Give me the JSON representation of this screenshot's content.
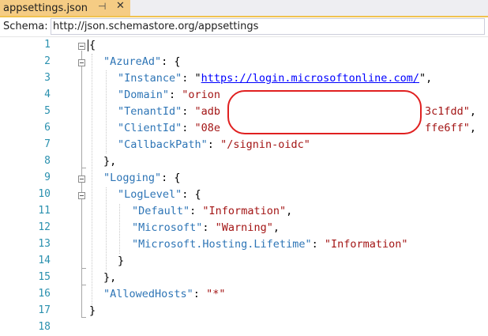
{
  "tab": {
    "title": "appsettings.json",
    "pin_glyph": "⊣",
    "close_glyph": "✕"
  },
  "schema": {
    "label": "Schema:",
    "value": "http://json.schemastore.org/appsettings"
  },
  "lines": [
    {
      "num": "1"
    },
    {
      "num": "2"
    },
    {
      "num": "3"
    },
    {
      "num": "4"
    },
    {
      "num": "5"
    },
    {
      "num": "6"
    },
    {
      "num": "7"
    },
    {
      "num": "8"
    },
    {
      "num": "9"
    },
    {
      "num": "10"
    },
    {
      "num": "11"
    },
    {
      "num": "12"
    },
    {
      "num": "13"
    },
    {
      "num": "14"
    },
    {
      "num": "15"
    },
    {
      "num": "16"
    },
    {
      "num": "17"
    },
    {
      "num": "18"
    }
  ],
  "code": {
    "l1_open": "{",
    "l2_key": "\"AzureAd\"",
    "l2_rest": ": {",
    "l3_key": "\"Instance\"",
    "l3_sep": ": \"",
    "l3_url": "https://login.microsoftonline.com/",
    "l3_end": "\",",
    "l4_key": "\"Domain\"",
    "l4_sep": ": ",
    "l4_val": "\"orion",
    "l5_key": "\"TenantId\"",
    "l5_sep": ": ",
    "l5_val_start": "\"adb",
    "l5_val_end": "3c1fdd\"",
    "l5_comma": ",",
    "l6_key": "\"ClientId\"",
    "l6_sep": ": ",
    "l6_val_start": "\"08e",
    "l6_val_end": "ffe6ff\"",
    "l6_comma": ",",
    "l7_key": "\"CallbackPath\"",
    "l7_sep": ": ",
    "l7_val": "\"/signin-oidc\"",
    "l8": "},",
    "l9_key": "\"Logging\"",
    "l9_rest": ": {",
    "l10_key": "\"LogLevel\"",
    "l10_rest": ": {",
    "l11_key": "\"Default\"",
    "l11_sep": ": ",
    "l11_val": "\"Information\"",
    "l11_comma": ",",
    "l12_key": "\"Microsoft\"",
    "l12_sep": ": ",
    "l12_val": "\"Warning\"",
    "l12_comma": ",",
    "l13_key": "\"Microsoft.Hosting.Lifetime\"",
    "l13_sep": ": ",
    "l13_val": "\"Information\"",
    "l14": "}",
    "l15": "},",
    "l16_key": "\"AllowedHosts\"",
    "l16_sep": ": ",
    "l16_val": "\"*\"",
    "l17": "}"
  },
  "colors": {
    "key": "#2e75b6",
    "string": "#a31515",
    "link": "#0000ff",
    "line_number": "#2b91af",
    "tab_active": "#f5cc84",
    "redaction_outline": "#e02020"
  }
}
